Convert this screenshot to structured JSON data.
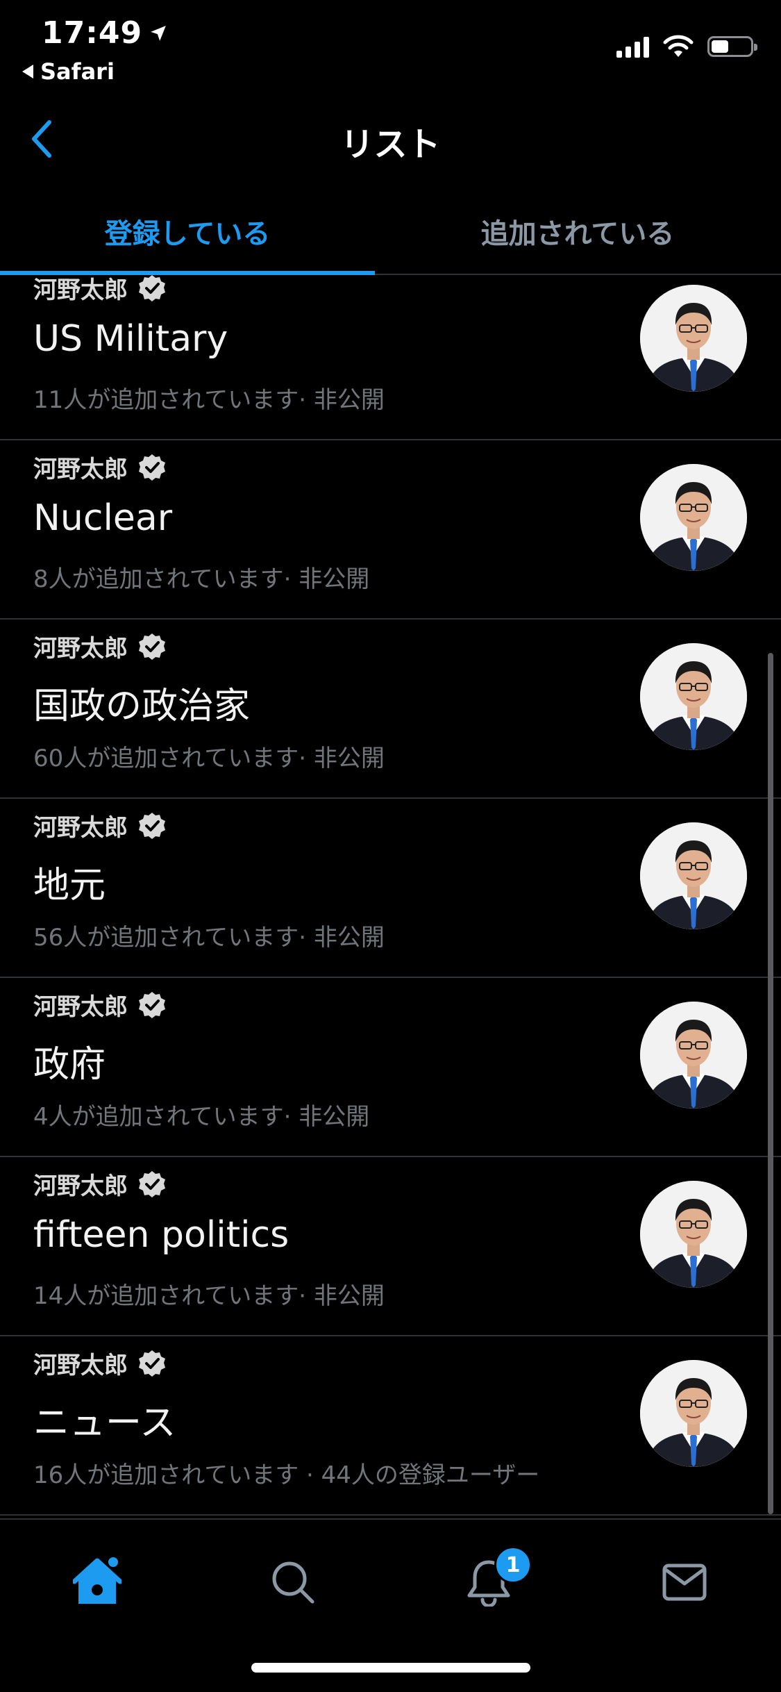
{
  "status_bar": {
    "time": "17:49",
    "back_app": "Safari",
    "battery_percent": 45
  },
  "header": {
    "title": "リスト"
  },
  "tabs": [
    {
      "label": "登録している",
      "active": true
    },
    {
      "label": "追加されている",
      "active": false
    }
  ],
  "lists": [
    {
      "owner": "河野太郎",
      "name": "US Military",
      "meta": "11人が追加されています· 非公開"
    },
    {
      "owner": "河野太郎",
      "name": "Nuclear",
      "meta": "8人が追加されています· 非公開"
    },
    {
      "owner": "河野太郎",
      "name": "国政の政治家",
      "meta": "60人が追加されています· 非公開"
    },
    {
      "owner": "河野太郎",
      "name": "地元",
      "meta": "56人が追加されています· 非公開"
    },
    {
      "owner": "河野太郎",
      "name": "政府",
      "meta": "4人が追加されています· 非公開"
    },
    {
      "owner": "河野太郎",
      "name": "fifteen politics",
      "meta": "14人が追加されています· 非公開"
    },
    {
      "owner": "河野太郎",
      "name": "ニュース",
      "meta": "16人が追加されています · 44人の登録ユーザー"
    }
  ],
  "tab_bar": {
    "items": [
      "home-icon",
      "search-icon",
      "bell-icon",
      "mail-icon"
    ],
    "notification_badge": "1"
  },
  "colors": {
    "accent": "#1d9bf0",
    "background": "#000000",
    "divider": "#2f3336",
    "secondary_text": "#71767b"
  }
}
